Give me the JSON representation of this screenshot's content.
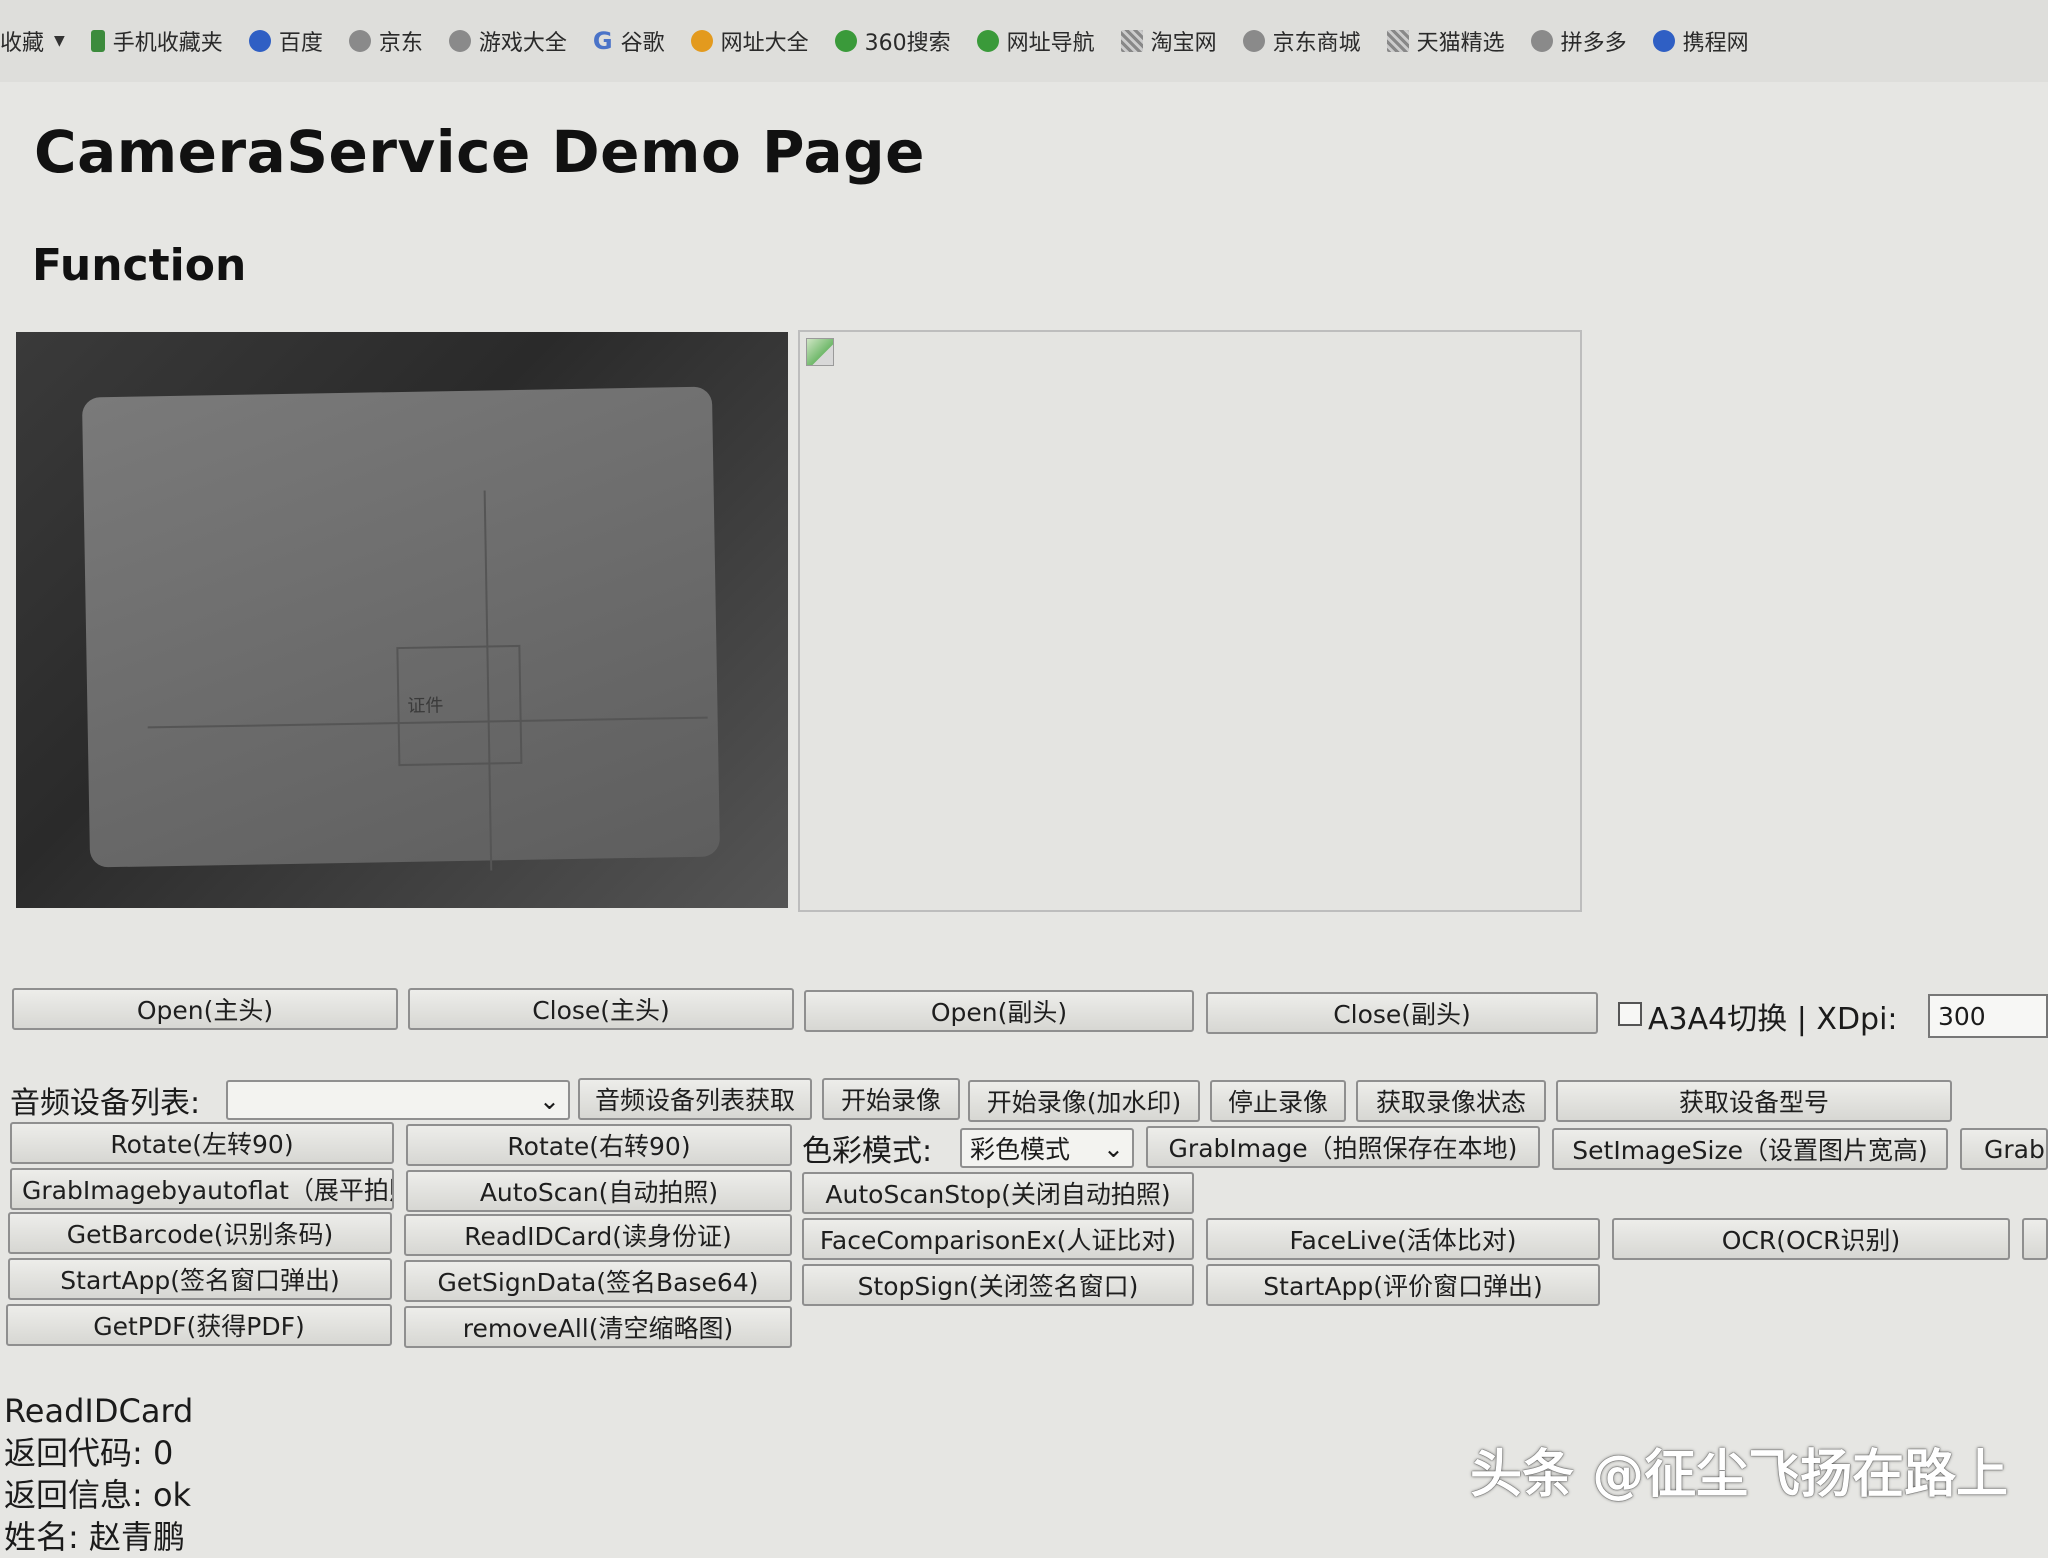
{
  "bookmarks": {
    "first": "收藏",
    "items": [
      {
        "label": "手机收藏夹",
        "icon": "phone-icon"
      },
      {
        "label": "百度",
        "icon": "baidu-paw-icon"
      },
      {
        "label": "京东",
        "icon": "globe-icon"
      },
      {
        "label": "游戏大全",
        "icon": "globe-icon"
      },
      {
        "label": "谷歌",
        "icon": "google-g-icon"
      },
      {
        "label": "网址大全",
        "icon": "plus-circle-icon"
      },
      {
        "label": "360搜索",
        "icon": "360-ring-icon"
      },
      {
        "label": "网址导航",
        "icon": "hao-check-icon"
      },
      {
        "label": "淘宝网",
        "icon": "grid-favicon-icon"
      },
      {
        "label": "京东商城",
        "icon": "globe-icon"
      },
      {
        "label": "天猫精选",
        "icon": "grid-favicon-icon"
      },
      {
        "label": "拼多多",
        "icon": "globe-icon"
      },
      {
        "label": "携程网",
        "icon": "ctrip-swirl-icon"
      }
    ]
  },
  "page": {
    "title": "CameraService Demo Page",
    "subtitle": "Function"
  },
  "preview": {
    "plate_label": "证件"
  },
  "controls": {
    "open_main": "Open(主头)",
    "close_main": "Close(主头)",
    "open_sub": "Open(副头)",
    "close_sub": "Close(副头)",
    "a3a4_label": "A3A4切换 | XDpi:",
    "xdpi_value": "300",
    "audio_label": "音频设备列表:",
    "audio_select": "",
    "get_audio_list": "音频设备列表获取",
    "start_record": "开始录像",
    "start_record_wm": "开始录像(加水印)",
    "stop_record": "停止录像",
    "record_status": "获取录像状态",
    "get_device_model": "获取设备型号",
    "rotate_left": "Rotate(左转90)",
    "rotate_right": "Rotate(右转90)",
    "color_mode_label": "色彩模式:",
    "color_mode_value": "彩色模式",
    "grab_image": "GrabImage（拍照保存在本地)",
    "set_image_size": "SetImageSize（设置图片宽高)",
    "grab_cut": "Grab",
    "grab_autoflat": "GrabImagebyautoflat（展平拍照",
    "auto_scan": "AutoScan(自动拍照)",
    "auto_scan_stop": "AutoScanStop(关闭自动拍照)",
    "get_barcode": "GetBarcode(识别条码)",
    "read_idcard": "ReadIDCard(读身份证)",
    "face_comparison": "FaceComparisonEx(人证比对)",
    "face_live": "FaceLive(活体比对)",
    "ocr": "OCR(OCR识别)",
    "start_app_sign": "StartApp(签名窗口弹出)",
    "get_sign_data": "GetSignData(签名Base64)",
    "stop_sign": "StopSign(关闭签名窗口)",
    "start_app_eval": "StartApp(评价窗口弹出)",
    "get_pdf": "GetPDF(获得PDF)",
    "remove_all": "removeAll(清空缩略图)"
  },
  "output": {
    "line1": "ReadIDCard",
    "line2": "返回代码: 0",
    "line3": "返回信息: ok",
    "line4": "姓名: 赵青鹏"
  },
  "watermark": "头条 @征尘飞扬在路上"
}
